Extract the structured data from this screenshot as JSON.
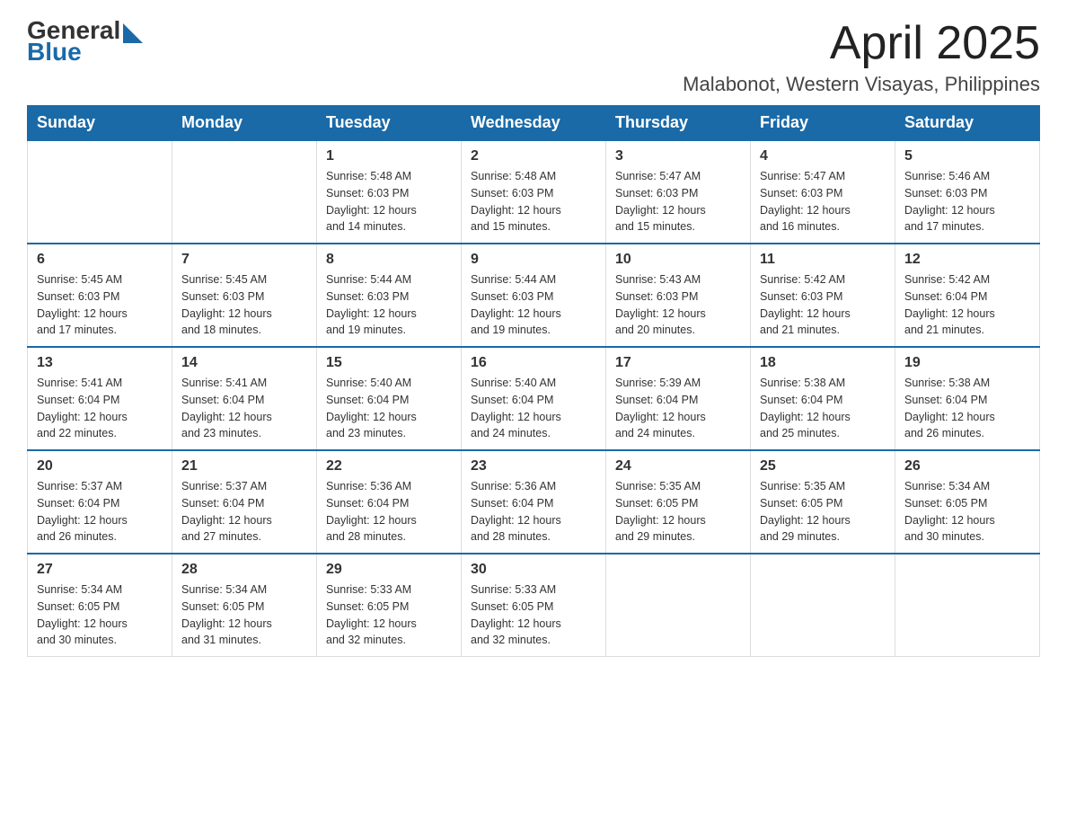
{
  "header": {
    "logo_general": "General",
    "logo_blue": "Blue",
    "month_year": "April 2025",
    "location": "Malabonot, Western Visayas, Philippines"
  },
  "weekdays": [
    "Sunday",
    "Monday",
    "Tuesday",
    "Wednesday",
    "Thursday",
    "Friday",
    "Saturday"
  ],
  "weeks": [
    [
      {
        "day": "",
        "info": ""
      },
      {
        "day": "",
        "info": ""
      },
      {
        "day": "1",
        "info": "Sunrise: 5:48 AM\nSunset: 6:03 PM\nDaylight: 12 hours\nand 14 minutes."
      },
      {
        "day": "2",
        "info": "Sunrise: 5:48 AM\nSunset: 6:03 PM\nDaylight: 12 hours\nand 15 minutes."
      },
      {
        "day": "3",
        "info": "Sunrise: 5:47 AM\nSunset: 6:03 PM\nDaylight: 12 hours\nand 15 minutes."
      },
      {
        "day": "4",
        "info": "Sunrise: 5:47 AM\nSunset: 6:03 PM\nDaylight: 12 hours\nand 16 minutes."
      },
      {
        "day": "5",
        "info": "Sunrise: 5:46 AM\nSunset: 6:03 PM\nDaylight: 12 hours\nand 17 minutes."
      }
    ],
    [
      {
        "day": "6",
        "info": "Sunrise: 5:45 AM\nSunset: 6:03 PM\nDaylight: 12 hours\nand 17 minutes."
      },
      {
        "day": "7",
        "info": "Sunrise: 5:45 AM\nSunset: 6:03 PM\nDaylight: 12 hours\nand 18 minutes."
      },
      {
        "day": "8",
        "info": "Sunrise: 5:44 AM\nSunset: 6:03 PM\nDaylight: 12 hours\nand 19 minutes."
      },
      {
        "day": "9",
        "info": "Sunrise: 5:44 AM\nSunset: 6:03 PM\nDaylight: 12 hours\nand 19 minutes."
      },
      {
        "day": "10",
        "info": "Sunrise: 5:43 AM\nSunset: 6:03 PM\nDaylight: 12 hours\nand 20 minutes."
      },
      {
        "day": "11",
        "info": "Sunrise: 5:42 AM\nSunset: 6:03 PM\nDaylight: 12 hours\nand 21 minutes."
      },
      {
        "day": "12",
        "info": "Sunrise: 5:42 AM\nSunset: 6:04 PM\nDaylight: 12 hours\nand 21 minutes."
      }
    ],
    [
      {
        "day": "13",
        "info": "Sunrise: 5:41 AM\nSunset: 6:04 PM\nDaylight: 12 hours\nand 22 minutes."
      },
      {
        "day": "14",
        "info": "Sunrise: 5:41 AM\nSunset: 6:04 PM\nDaylight: 12 hours\nand 23 minutes."
      },
      {
        "day": "15",
        "info": "Sunrise: 5:40 AM\nSunset: 6:04 PM\nDaylight: 12 hours\nand 23 minutes."
      },
      {
        "day": "16",
        "info": "Sunrise: 5:40 AM\nSunset: 6:04 PM\nDaylight: 12 hours\nand 24 minutes."
      },
      {
        "day": "17",
        "info": "Sunrise: 5:39 AM\nSunset: 6:04 PM\nDaylight: 12 hours\nand 24 minutes."
      },
      {
        "day": "18",
        "info": "Sunrise: 5:38 AM\nSunset: 6:04 PM\nDaylight: 12 hours\nand 25 minutes."
      },
      {
        "day": "19",
        "info": "Sunrise: 5:38 AM\nSunset: 6:04 PM\nDaylight: 12 hours\nand 26 minutes."
      }
    ],
    [
      {
        "day": "20",
        "info": "Sunrise: 5:37 AM\nSunset: 6:04 PM\nDaylight: 12 hours\nand 26 minutes."
      },
      {
        "day": "21",
        "info": "Sunrise: 5:37 AM\nSunset: 6:04 PM\nDaylight: 12 hours\nand 27 minutes."
      },
      {
        "day": "22",
        "info": "Sunrise: 5:36 AM\nSunset: 6:04 PM\nDaylight: 12 hours\nand 28 minutes."
      },
      {
        "day": "23",
        "info": "Sunrise: 5:36 AM\nSunset: 6:04 PM\nDaylight: 12 hours\nand 28 minutes."
      },
      {
        "day": "24",
        "info": "Sunrise: 5:35 AM\nSunset: 6:05 PM\nDaylight: 12 hours\nand 29 minutes."
      },
      {
        "day": "25",
        "info": "Sunrise: 5:35 AM\nSunset: 6:05 PM\nDaylight: 12 hours\nand 29 minutes."
      },
      {
        "day": "26",
        "info": "Sunrise: 5:34 AM\nSunset: 6:05 PM\nDaylight: 12 hours\nand 30 minutes."
      }
    ],
    [
      {
        "day": "27",
        "info": "Sunrise: 5:34 AM\nSunset: 6:05 PM\nDaylight: 12 hours\nand 30 minutes."
      },
      {
        "day": "28",
        "info": "Sunrise: 5:34 AM\nSunset: 6:05 PM\nDaylight: 12 hours\nand 31 minutes."
      },
      {
        "day": "29",
        "info": "Sunrise: 5:33 AM\nSunset: 6:05 PM\nDaylight: 12 hours\nand 32 minutes."
      },
      {
        "day": "30",
        "info": "Sunrise: 5:33 AM\nSunset: 6:05 PM\nDaylight: 12 hours\nand 32 minutes."
      },
      {
        "day": "",
        "info": ""
      },
      {
        "day": "",
        "info": ""
      },
      {
        "day": "",
        "info": ""
      }
    ]
  ]
}
